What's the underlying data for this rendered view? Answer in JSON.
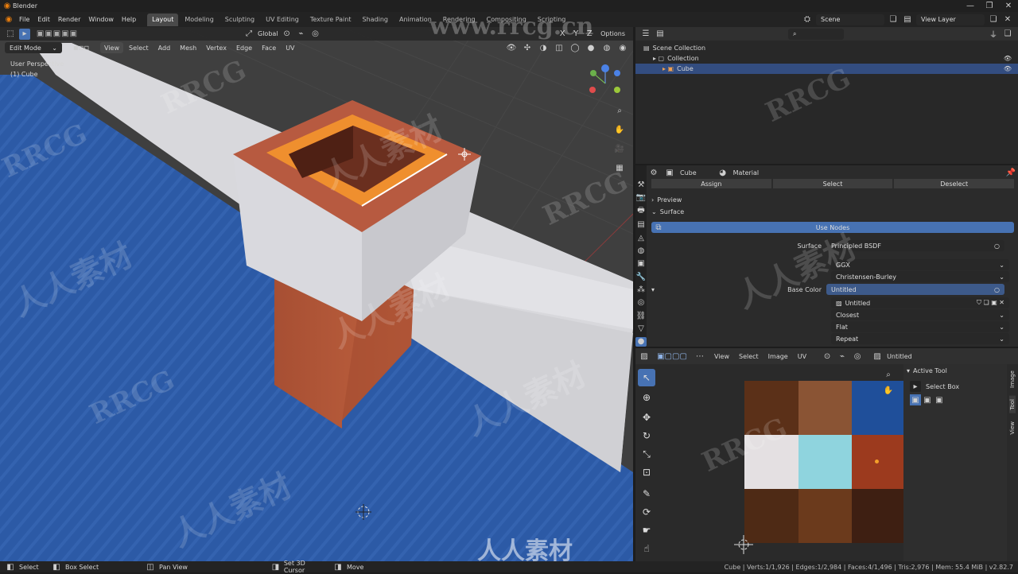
{
  "window": {
    "title": "Blender"
  },
  "menu": [
    "File",
    "Edit",
    "Render",
    "Window",
    "Help"
  ],
  "workspaces": [
    "Layout",
    "Modeling",
    "Sculpting",
    "UV Editing",
    "Texture Paint",
    "Shading",
    "Animation",
    "Rendering",
    "Compositing",
    "Scripting"
  ],
  "active_workspace": "Layout",
  "scene": {
    "name": "Scene",
    "view_layer": "View Layer"
  },
  "viewport": {
    "mode": "Edit Mode",
    "menus": [
      "View",
      "Select",
      "Add",
      "Mesh",
      "Vertex",
      "Edge",
      "Face",
      "UV"
    ],
    "transform_orientation": "Global",
    "options_label": "Options",
    "overlay_title": "User Perspective",
    "overlay_object": "(1) Cube",
    "gizmo_axes": [
      "X",
      "Y",
      "Z"
    ]
  },
  "outliner": {
    "items": [
      {
        "label": "Scene Collection",
        "level": 0
      },
      {
        "label": "Collection",
        "level": 1
      },
      {
        "label": "Cube",
        "level": 2,
        "selected": true
      }
    ]
  },
  "properties": {
    "object": "Cube",
    "material": "Material",
    "actions": [
      "Assign",
      "Select",
      "Deselect"
    ],
    "panels": [
      "Preview",
      "Surface"
    ],
    "use_nodes": "Use Nodes",
    "surface_label": "Surface",
    "surface_value": "Principled BSDF",
    "distribution": "GGX",
    "subsurface": "Christensen-Burley",
    "base_color_label": "Base Color",
    "base_color_value": "Untitled",
    "image_name": "Untitled",
    "interpolation": "Closest",
    "projection": "Flat",
    "extension": "Repeat"
  },
  "uv_editor": {
    "menus": [
      "View",
      "Select",
      "Image",
      "UV"
    ],
    "image": "Untitled",
    "active_tool_title": "Active Tool",
    "active_tool": "Select Box",
    "side_tabs": [
      "Image",
      "Tool",
      "View"
    ],
    "palette": [
      "#5b3018",
      "#8a5434",
      "#1f4f9a",
      "#e4e0e2",
      "#8fd4de",
      "#9c3a1e",
      "#4e2a15",
      "#6b3a1c",
      "#3e1f12"
    ]
  },
  "status_bar": {
    "items": [
      "Select",
      "Box Select",
      "Pan View",
      "Set 3D Cursor",
      "Move"
    ],
    "stats": "Cube | Verts:1/1,926 | Edges:1/2,984 | Faces:4/1,496 | Tris:2,976 | Mem: 55.4 MiB | v2.82.7"
  },
  "watermarks": [
    "www.rrcg.cn",
    "RRCG",
    "人人素材"
  ],
  "colors": {
    "accent": "#4772b3",
    "selection_orange": "#f08c28",
    "ground_blue": "#2f5aa7",
    "chimney_brick": "#b2563a",
    "wall_white": "#d9d9dc"
  }
}
